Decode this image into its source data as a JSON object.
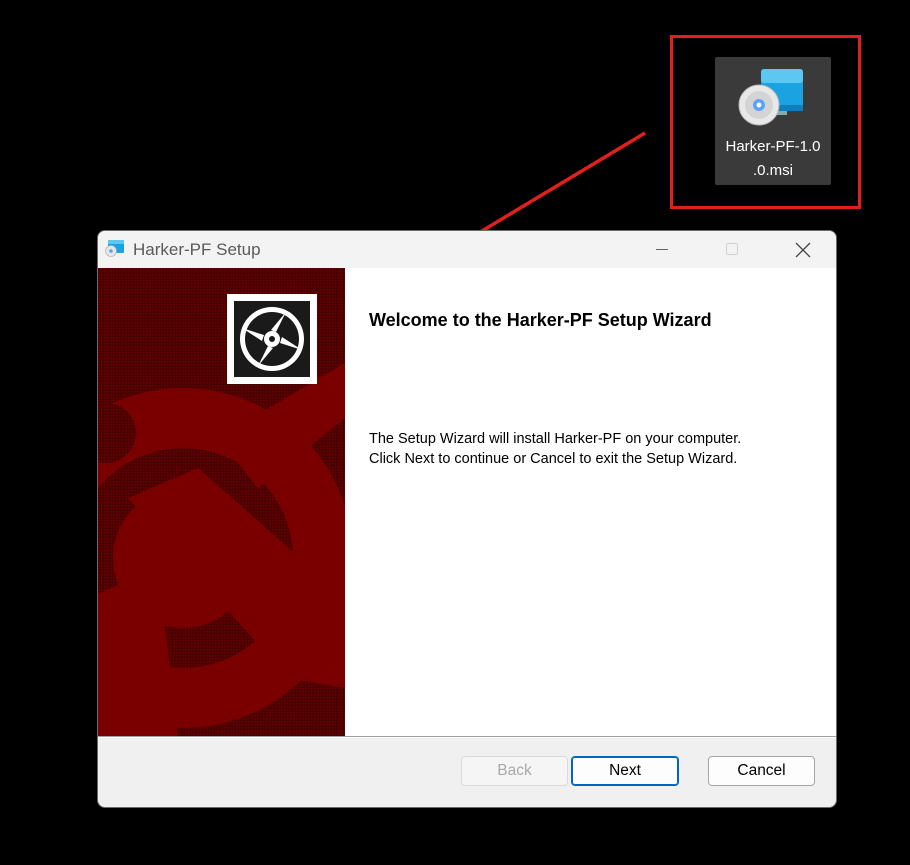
{
  "desktop": {
    "file_name": "Harker-PF-1.0.0.msi",
    "file_name_line1": "Harker-PF-1.0",
    "file_name_line2": ".0.msi",
    "icon": "installer-disc-icon",
    "highlight_color": "#e0201d"
  },
  "window": {
    "title": "Harker-PF Setup",
    "minimize_icon": "minimize-icon",
    "maximize_icon": "maximize-icon",
    "close_icon": "close-icon"
  },
  "wizard": {
    "heading": "Welcome to the Harker-PF Setup Wizard",
    "body_line1": "The Setup Wizard will install Harker-PF on your computer.",
    "body_line2": "Click Next to continue or Cancel to exit the Setup Wizard.",
    "banner_color": "#7a0000"
  },
  "buttons": {
    "back": "Back",
    "next": "Next",
    "cancel": "Cancel"
  }
}
